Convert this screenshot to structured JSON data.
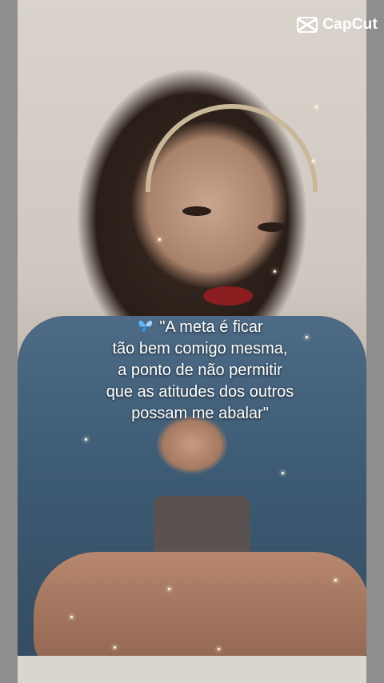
{
  "brand": {
    "name": "CapCut",
    "icon": "capcut-logo-icon"
  },
  "caption": {
    "icon": "butterfly-icon",
    "lines": [
      "\"A meta é ficar",
      "tão bem comigo mesma,",
      "a ponto de não permitir",
      "que as atitudes dos outros",
      "possam me abalar\""
    ]
  },
  "colors": {
    "caption_text": "#ffffff",
    "butterfly": "#5fb6ff",
    "side_bars": "#8e8e8e"
  }
}
